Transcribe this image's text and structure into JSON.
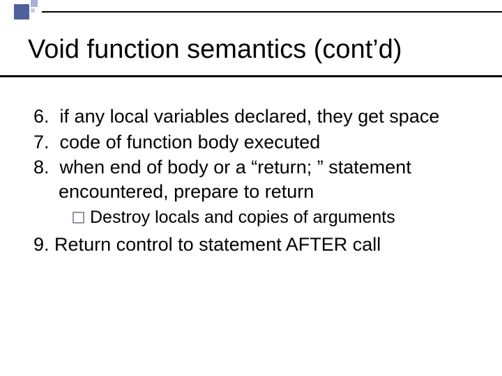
{
  "title": "Void function semantics (cont’d)",
  "items": [
    {
      "n": "6.",
      "text": "if any local variables declared, they get space"
    },
    {
      "n": "7.",
      "text": "code of function body executed"
    },
    {
      "n": "8.",
      "text": "when end of body or a “return; ” statement encountered, prepare to return"
    }
  ],
  "sub": {
    "text": "Destroy locals and copies of arguments"
  },
  "item9": {
    "n": "9.",
    "text": "Return control to statement AFTER call"
  }
}
